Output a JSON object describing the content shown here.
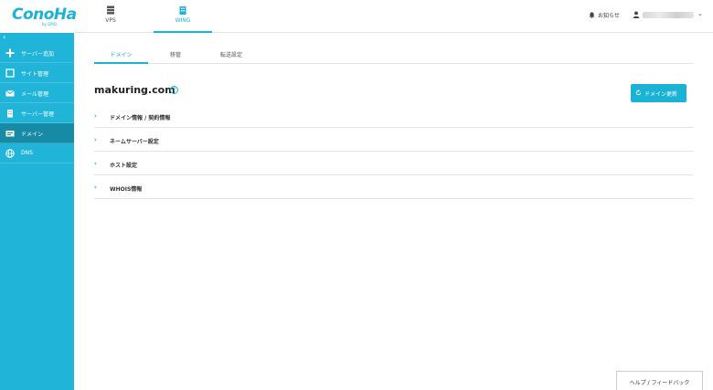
{
  "app": {
    "logo": "ConoHa",
    "logo_sub": "by GMO"
  },
  "header": {
    "tabs": [
      {
        "label": "VPS",
        "icon": "server-icon",
        "active": false
      },
      {
        "label": "WING",
        "icon": "building-icon",
        "active": true
      }
    ],
    "news_label": "お知らせ",
    "user_icon": "person-icon"
  },
  "sidebar": {
    "collapse": "‹",
    "items": [
      {
        "label": "サーバー追加",
        "icon": "plus-icon",
        "active": false
      },
      {
        "label": "サイト管理",
        "icon": "window-icon",
        "active": false
      },
      {
        "label": "メール管理",
        "icon": "mail-icon",
        "active": false
      },
      {
        "label": "サーバー管理",
        "icon": "server-building-icon",
        "active": false
      },
      {
        "label": "ドメイン",
        "icon": "domain-icon",
        "active": true
      },
      {
        "label": "DNS",
        "icon": "globe-icon",
        "active": false
      }
    ]
  },
  "subtabs": [
    {
      "label": "ドメイン",
      "active": true
    },
    {
      "label": "移管",
      "active": false
    },
    {
      "label": "転送設定",
      "active": false
    }
  ],
  "domain": {
    "name": "makuring.com",
    "help": "?"
  },
  "renew_button": {
    "label": "ドメイン更新",
    "icon": "refresh-icon"
  },
  "sections": [
    {
      "label": "ドメイン情報 / 契約情報"
    },
    {
      "label": "ネームサーバー設定"
    },
    {
      "label": "ホスト設定"
    },
    {
      "label": "WHOIS情報"
    }
  ],
  "section_arrow": "›",
  "help_feedback": "ヘルプ / フィードバック",
  "colors": {
    "accent": "#1ab3d6",
    "sidebar": "#20b4d8",
    "sidebar_active": "#178aa6"
  }
}
